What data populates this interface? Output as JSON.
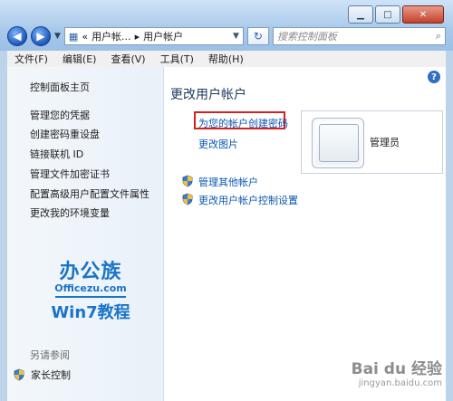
{
  "window": {
    "buttons": {
      "minimize": "▁",
      "maximize": "□",
      "close": "✕"
    }
  },
  "nav": {
    "address": {
      "crumb_1": "«",
      "crumb_2": "用户帐...",
      "sep": "▸",
      "crumb_3": "用户帐户"
    },
    "search_placeholder": "搜索控制面板"
  },
  "menu": [
    "文件(F)",
    "编辑(E)",
    "查看(V)",
    "工具(T)",
    "帮助(H)"
  ],
  "sidebar": {
    "home": "控制面板主页",
    "links": [
      "管理您的凭据",
      "创建密码重设盘",
      "链接联机 ID",
      "管理文件加密证书",
      "配置高级用户配置文件属性",
      "更改我的环境变量"
    ],
    "logo": {
      "big": "办公族",
      "url": "Officezu.com",
      "win7": "Win7教程"
    },
    "see_also": "另请参阅",
    "parental": "家长控制"
  },
  "main": {
    "title": "更改用户帐户",
    "link_create_password": "为您的帐户创建密码",
    "link_change_picture": "更改图片",
    "link_manage_other": "管理其他帐户",
    "link_uac": "更改用户帐户控制设置",
    "account_name": "管理员",
    "help": "?"
  },
  "watermark": {
    "brand": "Bai du 经验",
    "site": "jingyan.baidu.com"
  },
  "colors": {
    "link": "#0b57b2",
    "highlight": "#d42222",
    "logo": "#1a74c9"
  }
}
